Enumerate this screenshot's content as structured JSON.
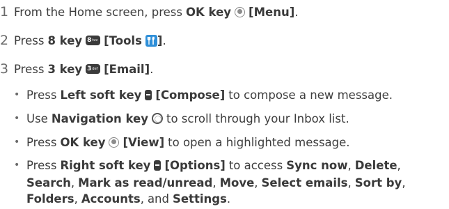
{
  "steps": [
    {
      "number": "1",
      "text_before": "From the Home screen, press",
      "key_label": "OK key",
      "key_icon": "ok-key-icon",
      "bracket_label": "[Menu]",
      "end": "."
    },
    {
      "number": "2",
      "text_before": "Press",
      "key_label": "8 key",
      "key_icon": "8-key-icon",
      "key_icon_digit": "8",
      "key_icon_letters": "tuv",
      "bracket_label_open": "[Tools",
      "bracket_icon": "tools-icon",
      "bracket_label_close": "]",
      "end": "."
    },
    {
      "number": "3",
      "text_before": "Press",
      "key_label": "3 key",
      "key_icon": "3-key-icon",
      "key_icon_digit": "3",
      "key_icon_letters": "def",
      "bracket_label": "[Email]",
      "end": "."
    }
  ],
  "bullets": [
    {
      "text_before": "Press",
      "key_label": "Left soft key",
      "key_icon": "soft-key-icon",
      "bracket_label": "[Compose]",
      "text_after": "to compose a new message."
    },
    {
      "text_before": "Use",
      "key_label": "Navigation key",
      "key_icon": "navigation-key-icon",
      "text_after": "to scroll through your Inbox list."
    },
    {
      "text_before": "Press",
      "key_label": "OK key",
      "key_icon": "ok-key-icon",
      "bracket_label": "[View]",
      "text_after": "to open a highlighted message."
    },
    {
      "text_before": "Press",
      "key_label": "Right soft key",
      "key_icon": "soft-key-icon",
      "bracket_label": "[Options]",
      "text_after": "to access",
      "options": [
        "Sync now",
        "Delete",
        "Search",
        "Mark as read/unread",
        "Move",
        "Select emails",
        "Sort by",
        "Folders",
        "Accounts",
        "Settings"
      ],
      "sep": ",",
      "and_word": "and",
      "end": "."
    }
  ],
  "bullet_char": "•",
  "colors": {
    "text": "#3d3d3d",
    "step_number": "#6a6a6a",
    "icon_dark": "#3b3b3b",
    "tools_icon_bg": "#2f8fd8"
  }
}
